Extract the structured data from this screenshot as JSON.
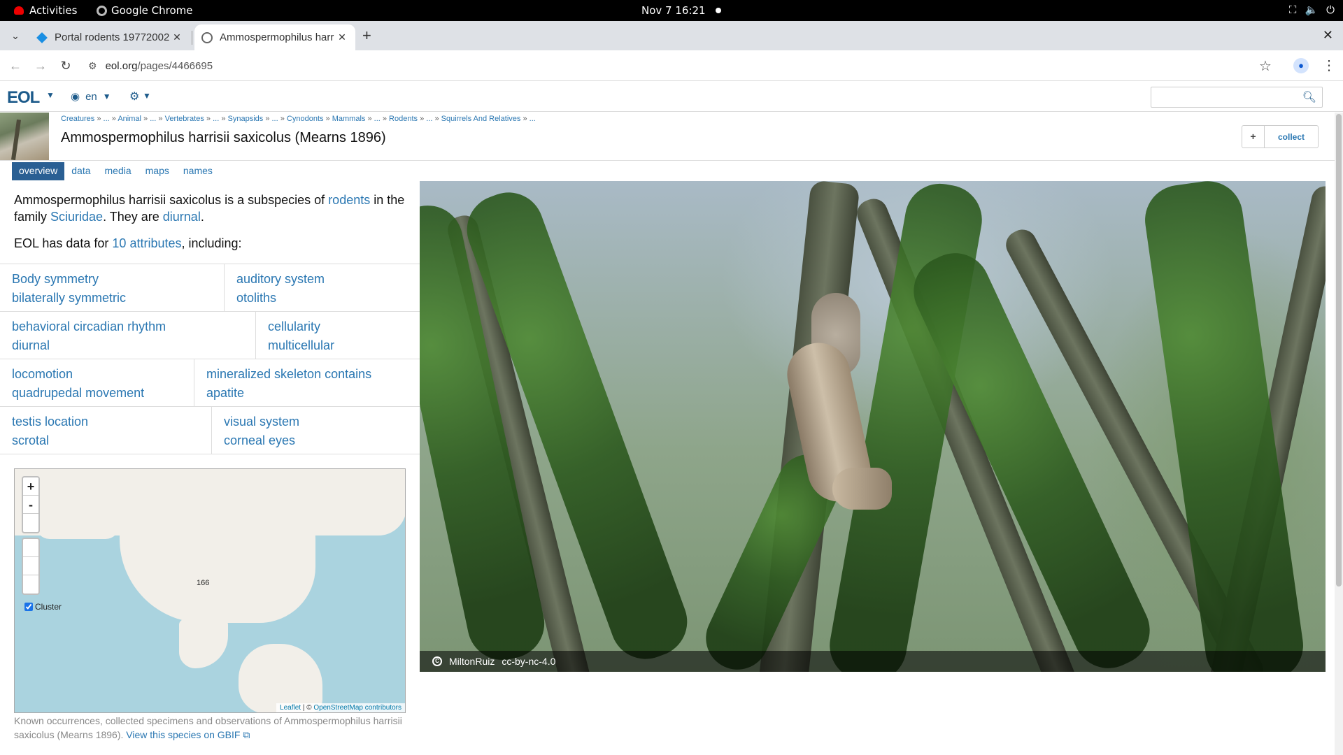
{
  "system": {
    "activities": "Activities",
    "app_name": "Google Chrome",
    "clock": "Nov 7  16:21"
  },
  "tabs": [
    {
      "title": "Portal rodents 19772002",
      "active": false
    },
    {
      "title": "Ammospermophilus harr",
      "active": true
    }
  ],
  "toolbar": {
    "url_domain": "eol.org",
    "url_path": "/pages/4466695"
  },
  "eol": {
    "logo": "EOL",
    "language": "en",
    "search_placeholder": "",
    "breadcrumb": [
      "Creatures",
      "...",
      "Animal",
      "...",
      "Vertebrates",
      "...",
      "Synapsids",
      "...",
      "Cynodonts",
      "Mammals",
      "...",
      "Rodents",
      "...",
      "Squirrels And Relatives",
      "..."
    ],
    "title": "Ammospermophilus harrisii saxicolus (Mearns 1896)",
    "collect_label": "collect",
    "subnav": [
      "overview",
      "data",
      "media",
      "maps",
      "names"
    ]
  },
  "overview": {
    "intro_prefix": "Ammospermophilus harrisii saxicolus is a subspecies of ",
    "intro_link1": "rodents",
    "intro_mid1": " in the family ",
    "intro_link2": "Sciuridae",
    "intro_mid2": ". They are ",
    "intro_link3": "diurnal",
    "intro_end": ".",
    "attrs_prefix": "EOL has data for ",
    "attrs_link": "10 attributes",
    "attrs_suffix": ", including:"
  },
  "traits": [
    {
      "left": {
        "name": "Body symmetry",
        "value": "bilaterally symmetric"
      },
      "right": {
        "name": "auditory system",
        "value": "otoliths"
      }
    },
    {
      "left": {
        "name": "behavioral circadian rhythm",
        "value": "diurnal"
      },
      "right": {
        "name": "cellularity",
        "value": "multicellular"
      }
    },
    {
      "left": {
        "name": "locomotion",
        "value": "quadrupedal movement"
      },
      "right": {
        "name": "mineralized skeleton contains",
        "value": "apatite"
      }
    },
    {
      "left": {
        "name": "testis location",
        "value": "scrotal"
      },
      "right": {
        "name": "visual system",
        "value": "corneal eyes"
      }
    }
  ],
  "map": {
    "zoom_in": "+",
    "zoom_out": "-",
    "cluster_count": "166",
    "cluster_label": "Cluster",
    "attrib_leaflet": "Leaflet",
    "attrib_sep": " | © ",
    "attrib_osm": "OpenStreetMap contributors",
    "caption": "Known occurrences, collected specimens and observations of Ammospermophilus harrisii saxicolus (Mearns 1896). ",
    "caption_link": "View this species on GBIF"
  },
  "photo": {
    "author": "MiltonRuiz",
    "license": "cc-by-nc-4.0"
  }
}
